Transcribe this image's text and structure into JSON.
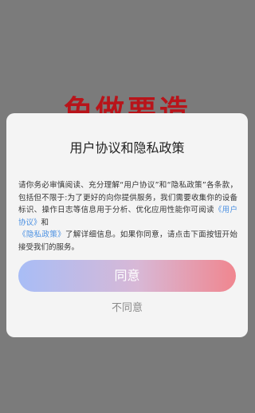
{
  "background": {
    "partial_title": "免做要造"
  },
  "dialog": {
    "title": "用户协议和隐私政策",
    "body_part1": "请你务必审慎阅读、充分理解“用户协议”和“隐私政策”各条款，包括但不限于:为了更好的向你提供服务，我们需要收集你的设备标识、操作日志等信息用于分析、优化应用性能你可阅读",
    "link_user_agreement": "《用户协议》",
    "body_and": "和",
    "link_privacy_policy": "《隐私政策》",
    "body_part2": "了解详细信息。如果你同意，请点击下面按钮开始接受我们的服务。",
    "agree_label": "同意",
    "disagree_label": "不同意"
  },
  "colors": {
    "overlay": "#7b7b7b",
    "dialog_bg": "#f4f4f4",
    "link": "#4a90e2",
    "gradient_start": "#a8bdf6",
    "gradient_end": "#f0868f",
    "background_title": "#b8141a"
  }
}
